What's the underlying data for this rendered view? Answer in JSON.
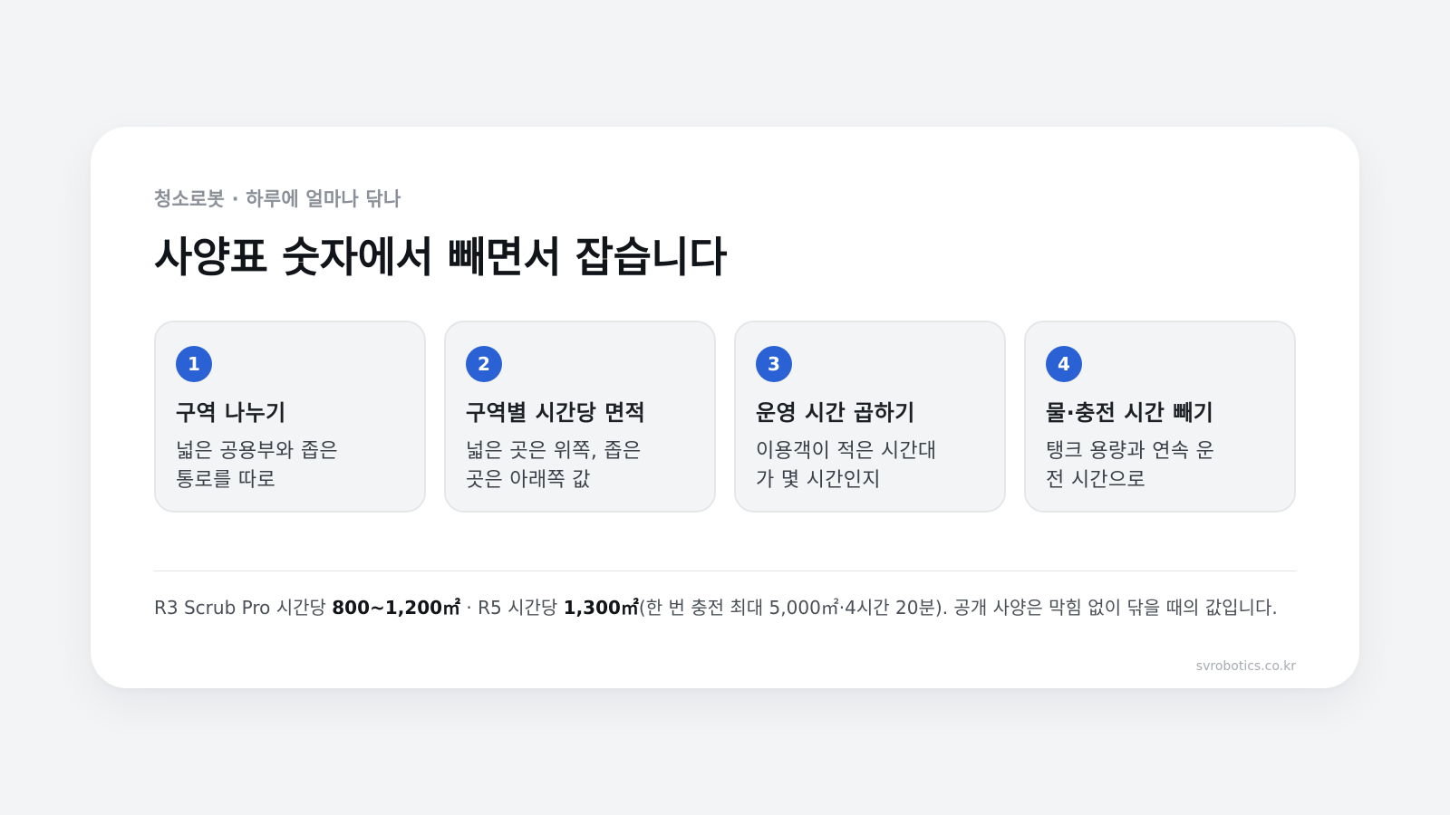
{
  "eyebrow": "청소로봇 · 하루에 얼마나 닦나",
  "headline": "사양표 숫자에서 빼면서 잡습니다",
  "steps": [
    {
      "number": "1",
      "title": "구역 나누기",
      "desc": "넓은 공용부와 좁은 통로를 따로"
    },
    {
      "number": "2",
      "title": "구역별 시간당 면적",
      "desc": "넓은 곳은 위쪽, 좁은 곳은 아래쪽 값"
    },
    {
      "number": "3",
      "title": "운영 시간 곱하기",
      "desc": "이용객이 적은 시간대가 몇 시간인지"
    },
    {
      "number": "4",
      "title": "물·충전 시간 빼기",
      "desc": "탱크 용량과 연속 운전 시간으로"
    }
  ],
  "note": {
    "part1": "R3 Scrub Pro 시간당 ",
    "r3_value": "800~1,200㎡",
    "part2": " · R5 시간당 ",
    "r5_value": "1,300㎡",
    "part3": "(한 번 충전 최대 5,000㎡·4시간 20분). 공개 사양은 막힘 없이 닦을 때의 값입니다."
  },
  "source": "svrobotics.co.kr",
  "colors": {
    "accent": "#2a62d6",
    "background": "#f3f4f6",
    "card": "#ffffff"
  }
}
